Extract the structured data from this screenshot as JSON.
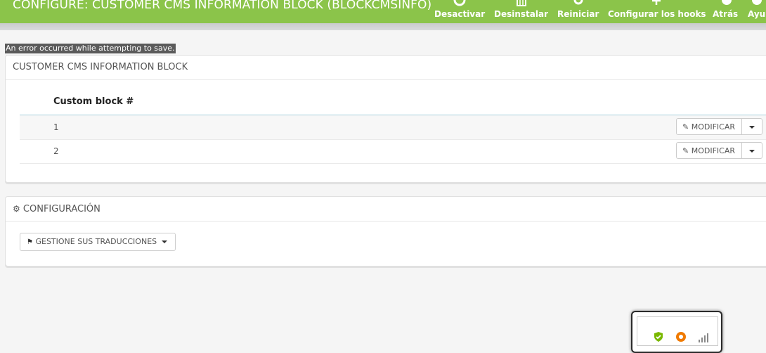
{
  "header": {
    "title": "CONFIGURE: CUSTOMER CMS INFORMATION BLOCK (BLOCKCMSINFO)",
    "toolbar": [
      {
        "label": "Desactivar",
        "icon": "power-icon"
      },
      {
        "label": "Desinstalar",
        "icon": "trash-icon"
      },
      {
        "label": "Reiniciar",
        "icon": "refresh-icon"
      },
      {
        "label": "Configurar los hooks",
        "icon": "anchor-icon"
      },
      {
        "label": "Atrás",
        "icon": "back-icon"
      },
      {
        "label": "Ayu",
        "icon": "help-icon"
      }
    ]
  },
  "alert": {
    "error": "An error occurred while attempting to save."
  },
  "cms_panel": {
    "heading": "CUSTOMER CMS INFORMATION BLOCK",
    "column_header": "Custom block #",
    "rows": [
      {
        "num": "1",
        "action": "MODIFICAR"
      },
      {
        "num": "2",
        "action": "MODIFICAR"
      }
    ]
  },
  "config_panel": {
    "heading": "CONFIGURACIÓN",
    "translate_button": "GESTIONE SUS TRADUCCIONES"
  },
  "tray": {
    "icons": [
      "shield-check-icon",
      "avast-icon",
      "signal-bars-icon"
    ]
  },
  "colors": {
    "header_bg": "#8bc44a",
    "error_bg": "#5b5b5b",
    "table_line": "#a6d0dc"
  }
}
